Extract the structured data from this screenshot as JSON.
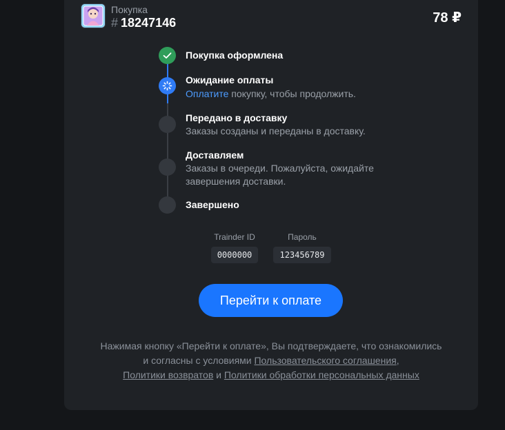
{
  "header": {
    "purchase_label": "Покупка",
    "hash_symbol": "#",
    "order_number": "18247146",
    "price": "78 ₽",
    "thumbnail_icon": "game-art-thumbnail-icon"
  },
  "steps": [
    {
      "title": "Покупка оформлена",
      "status": "done",
      "icon": "check-icon"
    },
    {
      "title": "Ожидание оплаты",
      "status": "active",
      "icon": "spinner-icon",
      "desc_link": "Оплатите",
      "desc_rest": " покупку, чтобы продолжить."
    },
    {
      "title": "Передано в доставку",
      "status": "pending",
      "desc": "Заказы созданы и переданы в доставку."
    },
    {
      "title": "Доставляем",
      "status": "pending",
      "desc": "Заказы в очереди. Пожалуйста, ожидайте завершения доставки."
    },
    {
      "title": "Завершено",
      "status": "pending"
    }
  ],
  "credentials": {
    "id_label": "Trainder ID",
    "id_value": "0000000",
    "password_label": "Пароль",
    "password_value": "123456789"
  },
  "pay_button_label": "Перейти к оплате",
  "legal": {
    "text_before": "Нажимая кнопку «Перейти к оплате», Вы подтверждаете, что ознакомились и согласны с условиями ",
    "link_terms": "Пользовательского соглашения",
    "comma": ",",
    "link_returns": "Политики возвратов",
    "and": " и ",
    "link_privacy": "Политики обработки персональных данных"
  },
  "colors": {
    "background": "#141619",
    "card": "#1f2226",
    "accent": "#1a76ff",
    "done": "#2f9d5a",
    "pending": "#34383e"
  }
}
